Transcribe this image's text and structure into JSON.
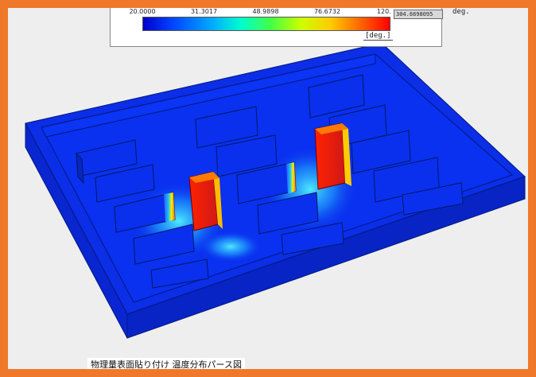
{
  "legend": {
    "ticks": [
      "20.0000",
      "31.3017",
      "48.9898",
      "76.6732",
      "120."
    ],
    "unit": "[deg.]",
    "readout": "304.6698095",
    "readout_unit": "deg."
  },
  "caption": "物理量表面貼り付け 温度分布パース図",
  "colors": {
    "frame": "#f0782a",
    "cold": "#0a2fe8",
    "hot": "#e52a1c"
  },
  "icons": [
    "color-scale-bar-icon"
  ]
}
